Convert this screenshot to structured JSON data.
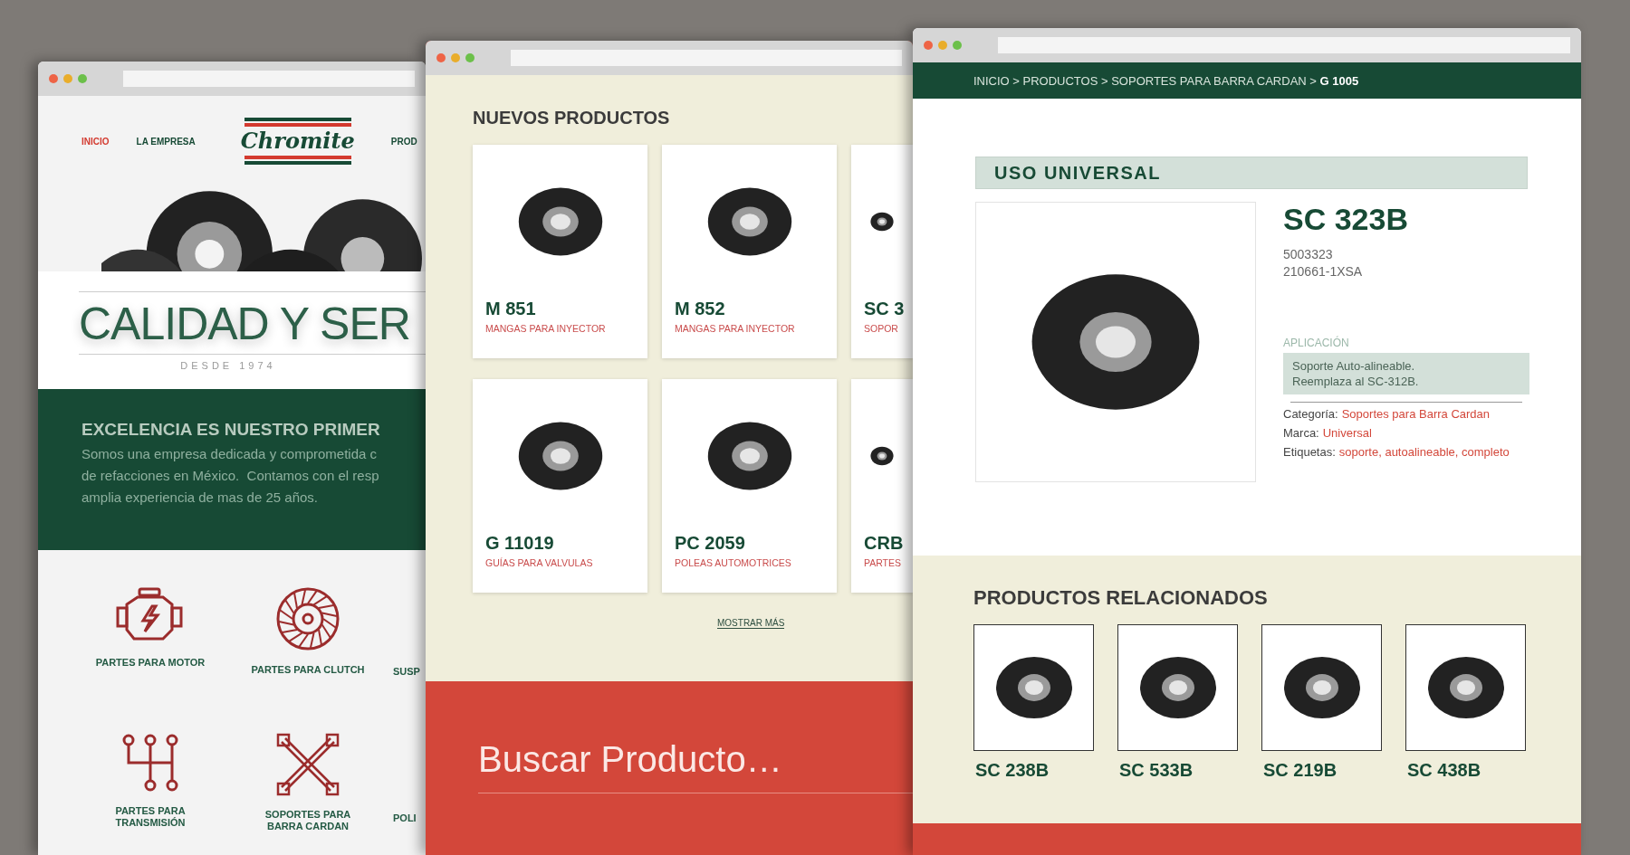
{
  "left_window": {
    "nav": [
      {
        "label": "INICIO",
        "selected": true
      },
      {
        "label": "LA EMPRESA",
        "selected": false
      },
      {
        "label": "PROD",
        "selected": false
      }
    ],
    "logo": "Chromite",
    "hero": {
      "title": "CALIDAD Y SER",
      "subtitle": "DESDE 1974"
    },
    "intro": {
      "heading": "EXCELENCIA ES NUESTRO PRIMER",
      "text": "Somos una empresa dedicada y comprometida c\nde refacciones en México.  Contamos con el resp\namplia experiencia de mas de 25 años."
    },
    "categories": [
      {
        "label": "PARTES PARA MOTOR",
        "kind": "engine"
      },
      {
        "label": "PARTES PARA CLUTCH",
        "kind": "clutch"
      },
      {
        "label": "SUSP",
        "kind": "text"
      },
      {
        "label": "PARTES PARA\nTRANSMISIÓN",
        "kind": "shifter"
      },
      {
        "label": "SOPORTES PARA\nBARRA CARDAN",
        "kind": "shaft"
      },
      {
        "label": "POLI",
        "kind": "text"
      }
    ]
  },
  "middle_window": {
    "heading": "NUEVOS PRODUCTOS",
    "products": [
      {
        "code": "M 851",
        "category": "MANGAS PARA INYECTOR"
      },
      {
        "code": "M 852",
        "category": "MANGAS PARA INYECTOR"
      },
      {
        "code": "SC 3",
        "category": "SOPOR"
      },
      {
        "code": "G 11019",
        "category": "GUÍAS PARA VALVULAS"
      },
      {
        "code": "PC 2059",
        "category": "POLEAS AUTOMOTRICES"
      },
      {
        "code": "CRB",
        "category": "PARTES"
      }
    ],
    "more_link": "MOSTRAR MÁS",
    "search": {
      "placeholder": "Buscar Producto…"
    }
  },
  "right_window": {
    "breadcrumb": "INICIO > PRODUCTOS > SOPORTES PARA BARRA CARDAN > **G 1005**",
    "banner": "USO UNIVERSAL",
    "product": {
      "code": "SC 323B",
      "numbers": [
        "5003323",
        "210661-1XSA"
      ],
      "application_label": "APLICACIÓN",
      "application": "Soporte Auto-alineable.\nReemplaza al SC-312B.",
      "meta": [
        {
          "label": "Categoría:",
          "value": "Soportes para Barra Cardan"
        },
        {
          "label": "Marca:",
          "value": "Universal"
        },
        {
          "label": "Etiquetas:",
          "value": "soporte, autoalineable, completo"
        }
      ]
    },
    "related": {
      "heading": "PRODUCTOS RELACIONADOS",
      "items": [
        {
          "code": "SC 238B"
        },
        {
          "code": "SC 533B"
        },
        {
          "code": "SC 219B"
        },
        {
          "code": "SC 438B"
        }
      ]
    }
  }
}
